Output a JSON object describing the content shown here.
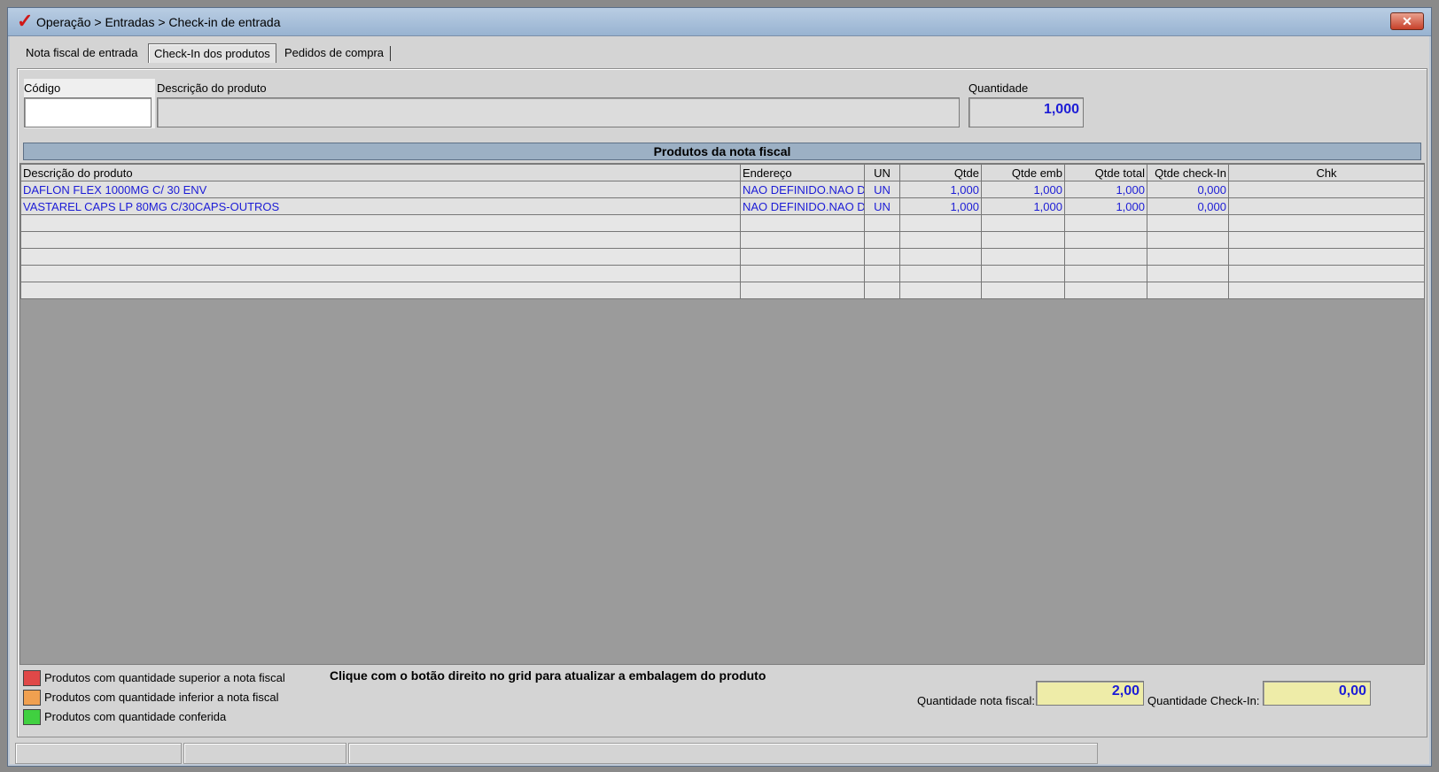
{
  "window": {
    "title": "Operação > Entradas > Check-in de entrada",
    "icon": "check-icon",
    "close_label": "✕"
  },
  "tabs": [
    {
      "label": "Nota fiscal de entrada",
      "active": false
    },
    {
      "label": "Check-In dos produtos",
      "active": true
    },
    {
      "label": "Pedidos de compra",
      "active": false
    }
  ],
  "form": {
    "codigo_label": "Código",
    "codigo_value": "",
    "descricao_label": "Descrição do produto",
    "descricao_value": "",
    "quantidade_label": "Quantidade",
    "quantidade_value": "1,000"
  },
  "grid": {
    "title": "Produtos da nota fiscal",
    "columns": [
      "Descrição do produto",
      "Endereço",
      "UN",
      "Qtde",
      "Qtde emb",
      "Qtde total",
      "Qtde check-In",
      "Chk"
    ],
    "rows": [
      {
        "descricao": "DAFLON FLEX 1000MG C/ 30 ENV",
        "endereco": "NAO DEFINIDO.NAO D",
        "un": "UN",
        "qtde": "1,000",
        "qtde_emb": "1,000",
        "qtde_total": "1,000",
        "qtde_checkin": "0,000",
        "chk": ""
      },
      {
        "descricao": "VASTAREL CAPS LP 80MG C/30CAPS-OUTROS",
        "endereco": "NAO DEFINIDO.NAO D",
        "un": "UN",
        "qtde": "1,000",
        "qtde_emb": "1,000",
        "qtde_total": "1,000",
        "qtde_checkin": "0,000",
        "chk": ""
      }
    ]
  },
  "legend": [
    {
      "label": "Produtos com quantidade superior a nota fiscal",
      "color": "#e04848"
    },
    {
      "label": "Produtos com quantidade inferior a nota fiscal",
      "color": "#f0a050"
    },
    {
      "label": "Produtos com quantidade conferida",
      "color": "#40d040"
    }
  ],
  "hint": "Clique com o botão direito no grid para atualizar a embalagem do produto",
  "totals": {
    "nota_fiscal_label": "Quantidade nota fiscal:",
    "nota_fiscal_value": "2,00",
    "checkin_label": "Quantidade Check-In:",
    "checkin_value": "0,00"
  },
  "colors": {
    "value_text": "#1c1cd6",
    "total_bg": "#eeeca8",
    "header_bar": "#9cb0c4"
  }
}
